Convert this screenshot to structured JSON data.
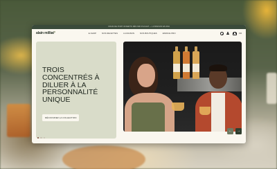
{
  "announcement": "FRAIS DE PORT OFFERTS DÈS 60€ D'ACHAT — LIVRAISON EN 48H",
  "brand": {
    "name": "alain milliat",
    "accent": "#6e7b4c"
  },
  "nav": {
    "items": [
      {
        "label": "E-SHOP"
      },
      {
        "label": "NOS RECETTES"
      },
      {
        "label": "LA MAISON"
      },
      {
        "label": "NOS BOUTIQUES"
      },
      {
        "label": "ESPACE PRO"
      }
    ],
    "language": "FR",
    "icons": [
      "search-icon",
      "user-icon",
      "cart-icon"
    ]
  },
  "hero": {
    "headline": "TROIS CONCENTRÉS À DILUER À LA PERSONNALITÉ UNIQUE",
    "cta_label": "DÉCOUVREZ LA COLLECTION",
    "slide_count": 3,
    "active_slide": 1,
    "prev_label": "←",
    "next_label": "→",
    "panel_color": "#d9dcc9",
    "nav_button_color": "#2f3e2e"
  }
}
